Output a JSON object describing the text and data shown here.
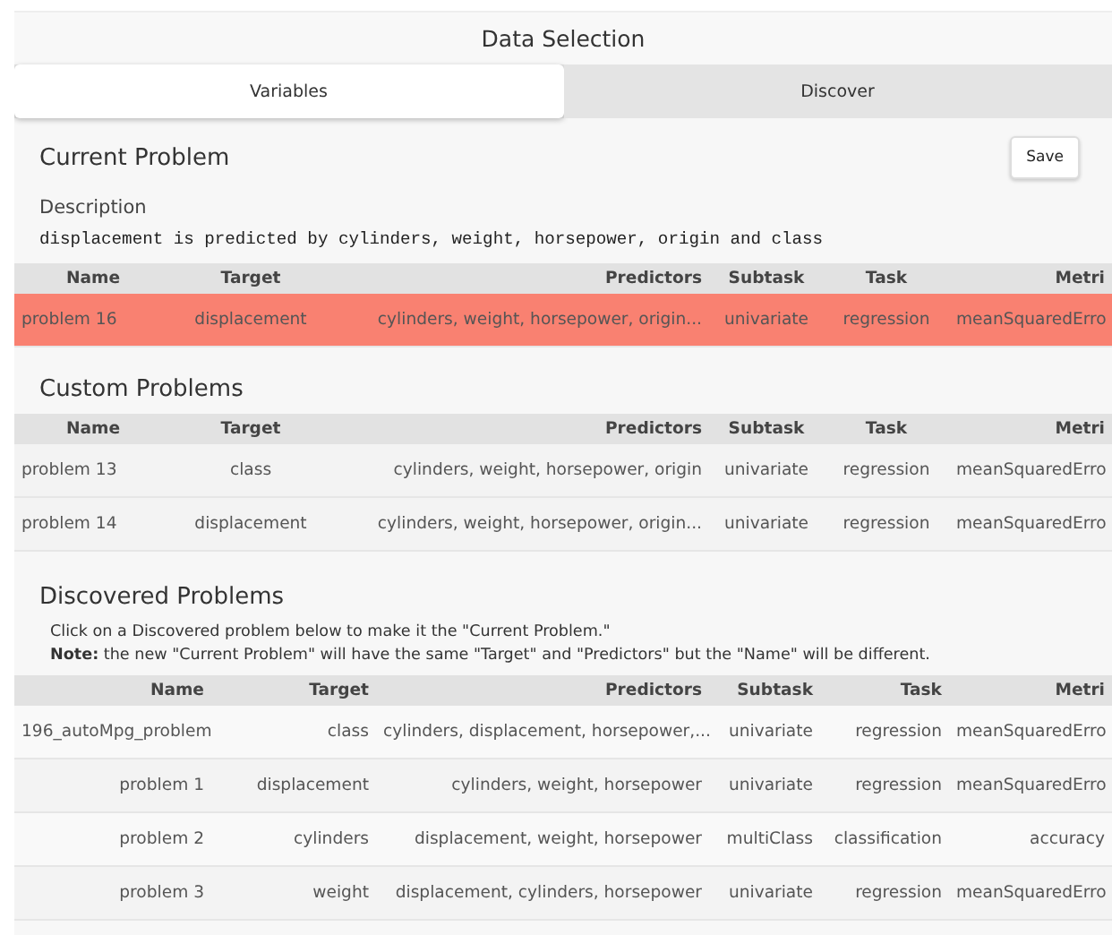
{
  "window": {
    "title": "Data Selection"
  },
  "tabs": [
    {
      "label": "Variables",
      "selected": true
    },
    {
      "label": "Discover",
      "selected": false
    }
  ],
  "current_problem": {
    "heading": "Current Problem",
    "save_button": "Save",
    "description_label": "Description",
    "description": "displacement is predicted by cylinders, weight, horsepower, origin and class",
    "table": {
      "kind": "left",
      "columns": [
        "Name",
        "Target",
        "Predictors",
        "Subtask",
        "Task",
        "Metri"
      ],
      "rows": [
        {
          "cells": [
            "problem 16",
            "displacement",
            "cylinders, weight, horsepower, origin...",
            "univariate",
            "regression",
            "meanSquaredErro"
          ],
          "selected": true
        }
      ]
    }
  },
  "custom_problems": {
    "heading": "Custom Problems",
    "table": {
      "kind": "left",
      "columns": [
        "Name",
        "Target",
        "Predictors",
        "Subtask",
        "Task",
        "Metri"
      ],
      "rows": [
        {
          "cells": [
            "problem 13",
            "class",
            "cylinders, weight, horsepower, origin",
            "univariate",
            "regression",
            "meanSquaredErro"
          ],
          "selected": false
        },
        {
          "cells": [
            "problem 14",
            "displacement",
            "cylinders, weight, horsepower, origin...",
            "univariate",
            "regression",
            "meanSquaredErro"
          ],
          "selected": false
        }
      ]
    }
  },
  "discovered_problems": {
    "heading": "Discovered Problems",
    "instructions": "Click on a Discovered problem below to make it the \"Current Problem.\"",
    "note": "**Note:** the new \"Current Problem\" will have the same \"Target\" and \"Predictors\" but the \"Name\" will be different.",
    "table": {
      "kind": "right",
      "columns": [
        "Name",
        "Target",
        "Predictors",
        "Subtask",
        "Task",
        "Metri"
      ],
      "rows": [
        {
          "cells": [
            "196_autoMpg_problem",
            "class",
            "cylinders, displacement, horsepower,...",
            "univariate",
            "regression",
            "meanSquaredErro"
          ],
          "selected": false
        },
        {
          "cells": [
            "problem 1",
            "displacement",
            "cylinders, weight, horsepower",
            "univariate",
            "regression",
            "meanSquaredErro"
          ],
          "selected": false
        },
        {
          "cells": [
            "problem 2",
            "cylinders",
            "displacement, weight, horsepower",
            "multiClass",
            "classification",
            "accuracy"
          ],
          "selected": false
        },
        {
          "cells": [
            "problem 3",
            "weight",
            "displacement, cylinders, horsepower",
            "univariate",
            "regression",
            "meanSquaredErro"
          ],
          "selected": false
        }
      ]
    }
  }
}
